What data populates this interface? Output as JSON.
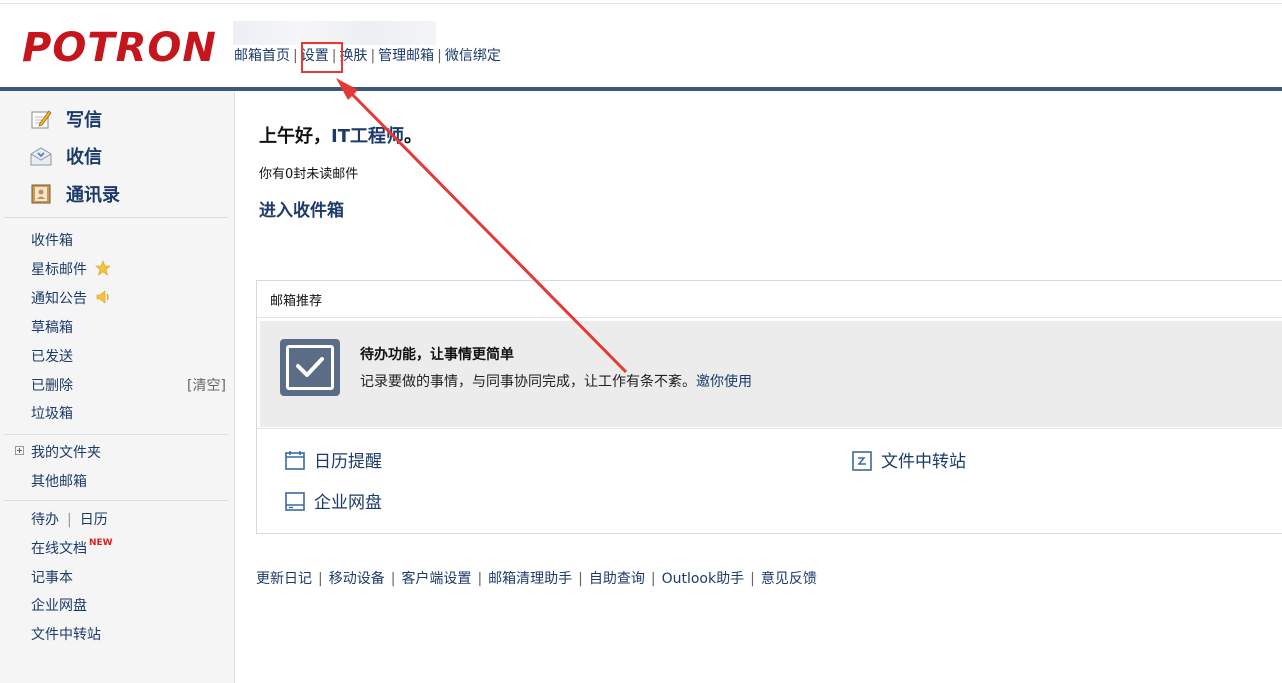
{
  "brand": {
    "logo_text": "POTRON",
    "logo_color": "#c4161c"
  },
  "topnav": {
    "items": [
      "邮箱首页",
      "设置",
      "换肤",
      "管理邮箱",
      "微信绑定"
    ]
  },
  "sidebar": {
    "big_items": [
      "写信",
      "收信",
      "通讯录"
    ],
    "folders": [
      "收件箱",
      "星标邮件",
      "通知公告",
      "草稿箱",
      "已发送",
      "已删除",
      "垃圾箱"
    ],
    "clear_label": "[清空]",
    "my_folders": "我的文件夹",
    "other_mailbox": "其他邮箱",
    "tools": {
      "todo": "待办",
      "calendar": "日历",
      "online_docs": "在线文档",
      "new_badge": "NEW",
      "notes": "记事本",
      "netdisk": "企业网盘",
      "file_transfer": "文件中转站"
    }
  },
  "main": {
    "greeting_prefix": "上午好，",
    "greeting_name": "IT工程师",
    "greeting_suffix": "。",
    "unread_text": "你有0封未读邮件",
    "go_inbox": "进入收件箱",
    "recommend": {
      "title": "邮箱推荐",
      "promo_title": "待办功能，让事情更简单",
      "promo_desc": "记录要做的事情，与同事协同完成，让工作有条不紊。",
      "promo_invite": "邀你使用",
      "tools": [
        "日历提醒",
        "文件中转站",
        "企业网盘"
      ]
    },
    "footer_links": [
      "更新日记",
      "移动设备",
      "客户端设置",
      "邮箱清理助手",
      "自助查询",
      "Outlook助手",
      "意见反馈"
    ]
  },
  "annotation": {
    "color": "#e53935"
  },
  "colors": {
    "link": "#1c3b6b",
    "header_bar": "#3b5878",
    "sidebar_bg": "#f5f5f5"
  }
}
